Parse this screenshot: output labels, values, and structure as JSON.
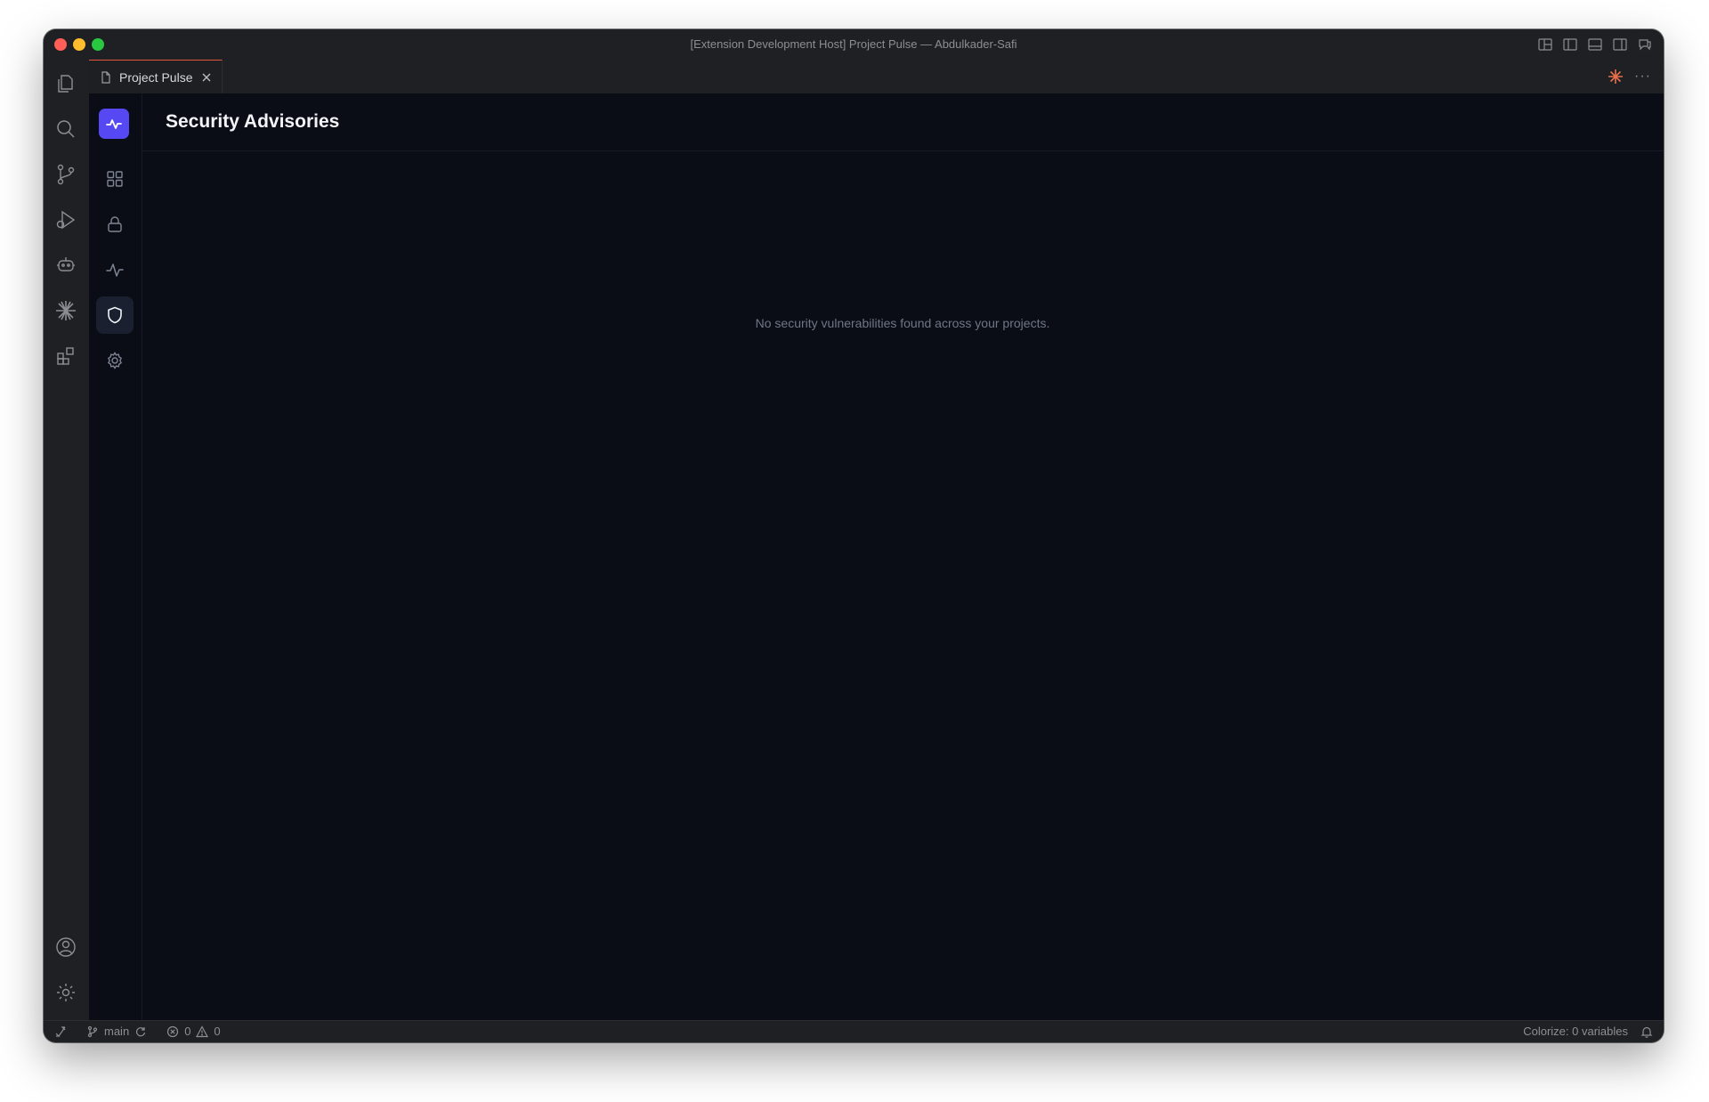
{
  "window": {
    "title": "[Extension Development Host] Project Pulse — Abdulkader-Safi"
  },
  "activity_bar": {
    "items": [
      "explorer-icon",
      "search-icon",
      "source-control-icon",
      "run-debug-icon",
      "copilot-icon",
      "claude-icon",
      "extensions-icon"
    ],
    "bottom": [
      "account-icon",
      "manage-gear-icon"
    ]
  },
  "tab": {
    "label": "Project Pulse"
  },
  "app": {
    "nav": [
      "dashboard-icon",
      "lock-icon",
      "activity-icon",
      "shield-icon",
      "settings-icon"
    ],
    "active_nav": "shield-icon",
    "accent_color": "#5648f2"
  },
  "page": {
    "title": "Security Advisories",
    "empty_message": "No security vulnerabilities found across your projects."
  },
  "status_bar": {
    "branch": "main",
    "errors": "0",
    "warnings": "0",
    "colorize": "Colorize: 0 variables"
  },
  "colors": {
    "tab_accent": "#e2553a",
    "background": "#0a0d16"
  }
}
